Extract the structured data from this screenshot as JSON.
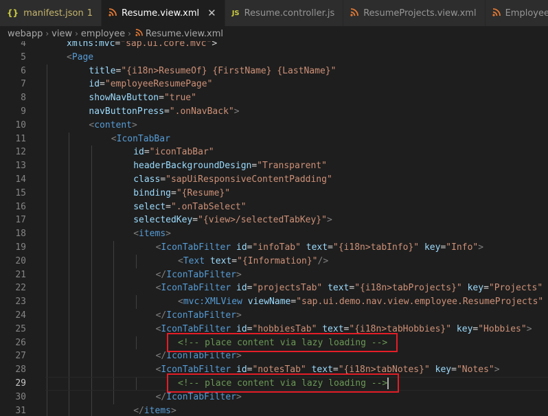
{
  "tabs": [
    {
      "icon": "{}",
      "label": "manifest.json",
      "badge": "1",
      "active": false
    },
    {
      "icon": "rss",
      "label": "Resume.view.xml",
      "close": "✕",
      "active": true
    },
    {
      "icon": "JS",
      "label": "Resume.controller.js",
      "active": false
    },
    {
      "icon": "rss",
      "label": "ResumeProjects.view.xml",
      "active": false
    },
    {
      "icon": "rss",
      "label": "Employee",
      "active": false
    }
  ],
  "breadcrumb": [
    "webapp",
    "view",
    "employee",
    "Resume.view.xml"
  ],
  "editor": {
    "current_line": 29,
    "lines": [
      {
        "n": "4",
        "ind": 1,
        "t": [
          [
            "attr",
            "xmlns:mvc"
          ],
          [
            "p",
            "="
          ],
          [
            "str",
            "\"sap.ui.core.mvc\""
          ],
          [
            "p",
            ">"
          ]
        ]
      },
      {
        "n": "5",
        "ind": 1,
        "t": [
          [
            "ptag",
            "<"
          ],
          [
            "tag",
            "Page"
          ]
        ]
      },
      {
        "n": "6",
        "ind": 2,
        "t": [
          [
            "attr",
            "title"
          ],
          [
            "p",
            "="
          ],
          [
            "str",
            "\"{i18n>ResumeOf} {FirstName} {LastName}\""
          ]
        ]
      },
      {
        "n": "7",
        "ind": 2,
        "t": [
          [
            "attr",
            "id"
          ],
          [
            "p",
            "="
          ],
          [
            "str",
            "\"employeeResumePage\""
          ]
        ]
      },
      {
        "n": "8",
        "ind": 2,
        "t": [
          [
            "attr",
            "showNavButton"
          ],
          [
            "p",
            "="
          ],
          [
            "str",
            "\"true\""
          ]
        ]
      },
      {
        "n": "9",
        "ind": 2,
        "t": [
          [
            "attr",
            "navButtonPress"
          ],
          [
            "p",
            "="
          ],
          [
            "str",
            "\".onNavBack\""
          ],
          [
            "ptag",
            ">"
          ]
        ]
      },
      {
        "n": "10",
        "ind": 2,
        "t": [
          [
            "ptag",
            "<"
          ],
          [
            "tag",
            "content"
          ],
          [
            "ptag",
            ">"
          ]
        ]
      },
      {
        "n": "11",
        "ind": 3,
        "t": [
          [
            "ptag",
            "<"
          ],
          [
            "tag",
            "IconTabBar"
          ]
        ]
      },
      {
        "n": "12",
        "ind": 4,
        "t": [
          [
            "attr",
            "id"
          ],
          [
            "p",
            "="
          ],
          [
            "str",
            "\"iconTabBar\""
          ]
        ]
      },
      {
        "n": "13",
        "ind": 4,
        "t": [
          [
            "attr",
            "headerBackgroundDesign"
          ],
          [
            "p",
            "="
          ],
          [
            "str",
            "\"Transparent\""
          ]
        ]
      },
      {
        "n": "14",
        "ind": 4,
        "t": [
          [
            "attr",
            "class"
          ],
          [
            "p",
            "="
          ],
          [
            "str",
            "\"sapUiResponsiveContentPadding\""
          ]
        ]
      },
      {
        "n": "15",
        "ind": 4,
        "t": [
          [
            "attr",
            "binding"
          ],
          [
            "p",
            "="
          ],
          [
            "str",
            "\"{Resume}\""
          ]
        ]
      },
      {
        "n": "16",
        "ind": 4,
        "t": [
          [
            "attr",
            "select"
          ],
          [
            "p",
            "="
          ],
          [
            "str",
            "\".onTabSelect\""
          ]
        ]
      },
      {
        "n": "17",
        "ind": 4,
        "t": [
          [
            "attr",
            "selectedKey"
          ],
          [
            "p",
            "="
          ],
          [
            "str",
            "\"{view>/selectedTabKey}\""
          ],
          [
            "ptag",
            ">"
          ]
        ]
      },
      {
        "n": "18",
        "ind": 4,
        "t": [
          [
            "ptag",
            "<"
          ],
          [
            "tag",
            "items"
          ],
          [
            "ptag",
            ">"
          ]
        ]
      },
      {
        "n": "19",
        "ind": 5,
        "t": [
          [
            "ptag",
            "<"
          ],
          [
            "tag",
            "IconTabFilter"
          ],
          [
            "p",
            " "
          ],
          [
            "attr",
            "id"
          ],
          [
            "p",
            "="
          ],
          [
            "str",
            "\"infoTab\""
          ],
          [
            "p",
            " "
          ],
          [
            "attr",
            "text"
          ],
          [
            "p",
            "="
          ],
          [
            "str",
            "\"{i18n>tabInfo}\""
          ],
          [
            "p",
            " "
          ],
          [
            "attr",
            "key"
          ],
          [
            "p",
            "="
          ],
          [
            "str",
            "\"Info\""
          ],
          [
            "ptag",
            ">"
          ]
        ]
      },
      {
        "n": "20",
        "ind": 6,
        "t": [
          [
            "ptag",
            "<"
          ],
          [
            "tag",
            "Text"
          ],
          [
            "p",
            " "
          ],
          [
            "attr",
            "text"
          ],
          [
            "p",
            "="
          ],
          [
            "str",
            "\"{Information}\""
          ],
          [
            "ptag",
            "/>"
          ]
        ]
      },
      {
        "n": "21",
        "ind": 5,
        "t": [
          [
            "ptag",
            "</"
          ],
          [
            "tag",
            "IconTabFilter"
          ],
          [
            "ptag",
            ">"
          ]
        ]
      },
      {
        "n": "22",
        "ind": 5,
        "t": [
          [
            "ptag",
            "<"
          ],
          [
            "tag",
            "IconTabFilter"
          ],
          [
            "p",
            " "
          ],
          [
            "attr",
            "id"
          ],
          [
            "p",
            "="
          ],
          [
            "str",
            "\"projectsTab\""
          ],
          [
            "p",
            " "
          ],
          [
            "attr",
            "text"
          ],
          [
            "p",
            "="
          ],
          [
            "str",
            "\"{i18n>tabProjects}\""
          ],
          [
            "p",
            " "
          ],
          [
            "attr",
            "key"
          ],
          [
            "p",
            "="
          ],
          [
            "str",
            "\"Projects\""
          ]
        ]
      },
      {
        "n": "23",
        "ind": 6,
        "t": [
          [
            "ptag",
            "<"
          ],
          [
            "tag",
            "mvc:XMLView"
          ],
          [
            "p",
            " "
          ],
          [
            "attr",
            "viewName"
          ],
          [
            "p",
            "="
          ],
          [
            "str",
            "\"sap.ui.demo.nav.view.employee.ResumeProjects\""
          ]
        ]
      },
      {
        "n": "24",
        "ind": 5,
        "t": [
          [
            "ptag",
            "</"
          ],
          [
            "tag",
            "IconTabFilter"
          ],
          [
            "ptag",
            ">"
          ]
        ]
      },
      {
        "n": "25",
        "ind": 5,
        "t": [
          [
            "ptag",
            "<"
          ],
          [
            "tag",
            "IconTabFilter"
          ],
          [
            "p",
            " "
          ],
          [
            "attr",
            "id"
          ],
          [
            "p",
            "="
          ],
          [
            "str",
            "\"hobbiesTab\""
          ],
          [
            "p",
            " "
          ],
          [
            "attr",
            "text"
          ],
          [
            "p",
            "="
          ],
          [
            "str",
            "\"{i18n>tabHobbies}\""
          ],
          [
            "p",
            " "
          ],
          [
            "attr",
            "key"
          ],
          [
            "p",
            "="
          ],
          [
            "str",
            "\"Hobbies\""
          ],
          [
            "ptag",
            ">"
          ]
        ]
      },
      {
        "n": "26",
        "ind": 6,
        "t": [
          [
            "cmt",
            "<!-- place content via lazy loading -->"
          ]
        ]
      },
      {
        "n": "27",
        "ind": 5,
        "t": [
          [
            "ptag",
            "</"
          ],
          [
            "tag",
            "IconTabFilter"
          ],
          [
            "ptag",
            ">"
          ]
        ]
      },
      {
        "n": "28",
        "ind": 5,
        "t": [
          [
            "ptag",
            "<"
          ],
          [
            "tag",
            "IconTabFilter"
          ],
          [
            "p",
            " "
          ],
          [
            "attr",
            "id"
          ],
          [
            "p",
            "="
          ],
          [
            "str",
            "\"notesTab\""
          ],
          [
            "p",
            " "
          ],
          [
            "attr",
            "text"
          ],
          [
            "p",
            "="
          ],
          [
            "str",
            "\"{i18n>tabNotes}\""
          ],
          [
            "p",
            " "
          ],
          [
            "attr",
            "key"
          ],
          [
            "p",
            "="
          ],
          [
            "str",
            "\"Notes\""
          ],
          [
            "ptag",
            ">"
          ]
        ]
      },
      {
        "n": "29",
        "ind": 6,
        "t": [
          [
            "cmt",
            "<!-- place content via lazy loading -->"
          ]
        ]
      },
      {
        "n": "30",
        "ind": 5,
        "t": [
          [
            "ptag",
            "</"
          ],
          [
            "tag",
            "IconTabFilter"
          ],
          [
            "ptag",
            ">"
          ]
        ]
      },
      {
        "n": "31",
        "ind": 4,
        "t": [
          [
            "ptag",
            "</"
          ],
          [
            "tag",
            "items"
          ],
          [
            "ptag",
            ">"
          ]
        ]
      }
    ]
  },
  "highlight_color": "#e51d27"
}
